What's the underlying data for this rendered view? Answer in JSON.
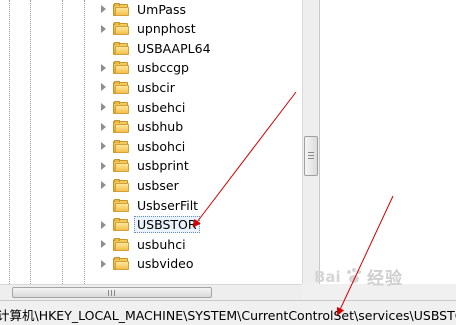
{
  "tree": {
    "items": [
      {
        "label": "UmPass",
        "expandable": true
      },
      {
        "label": "upnphost",
        "expandable": true
      },
      {
        "label": "USBAAPL64",
        "expandable": false
      },
      {
        "label": "usbccgp",
        "expandable": true
      },
      {
        "label": "usbcir",
        "expandable": true
      },
      {
        "label": "usbehci",
        "expandable": true
      },
      {
        "label": "usbhub",
        "expandable": true
      },
      {
        "label": "usbohci",
        "expandable": true
      },
      {
        "label": "usbprint",
        "expandable": true
      },
      {
        "label": "usbser",
        "expandable": true
      },
      {
        "label": "UsbserFilt",
        "expandable": false
      },
      {
        "label": "USBSTOR",
        "expandable": true,
        "selected": true
      },
      {
        "label": "usbuhci",
        "expandable": true
      },
      {
        "label": "usbvideo",
        "expandable": true
      }
    ]
  },
  "status_bar": {
    "path": "计算机\\HKEY_LOCAL_MACHINE\\SYSTEM\\CurrentControlSet\\services\\USBSTOR"
  },
  "watermark": {
    "text": "经验"
  },
  "colors": {
    "annotation_arrow": "#d40000",
    "selection_border": "#6b8cbf"
  }
}
